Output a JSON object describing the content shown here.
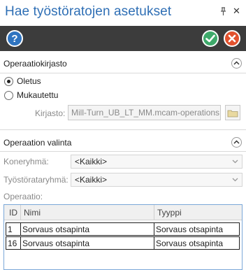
{
  "window": {
    "title": "Hae työstöratojen asetukset",
    "pin_glyph": "⌂",
    "close_glyph": "✕"
  },
  "toolbar": {
    "help_icon": "help-icon",
    "ok_icon": "check-icon",
    "cancel_icon": "cancel-icon"
  },
  "library_section": {
    "title": "Operaatiokirjasto",
    "options": [
      {
        "label": "Oletus",
        "checked": true
      },
      {
        "label": "Mukautettu",
        "checked": false
      }
    ],
    "library_label": "Kirjasto:",
    "library_value": "Mill-Turn_UB_LT_MM.mcam-operations"
  },
  "selection_section": {
    "title": "Operaation valinta",
    "machine_group_label": "Koneryhmä:",
    "machine_group_value": "<Kaikki>",
    "toolpath_group_label": "Työstörataryhmä:",
    "toolpath_group_value": "<Kaikki>",
    "operation_label": "Operaatio:"
  },
  "grid": {
    "columns": [
      "ID",
      "Nimi",
      "Tyyppi"
    ],
    "rows": [
      {
        "id": "1",
        "name": "Sorvaus otsapinta",
        "type": "Sorvaus otsapinta"
      },
      {
        "id": "16",
        "name": "Sorvaus otsapinta",
        "type": "Sorvaus otsapinta"
      }
    ]
  },
  "colors": {
    "title": "#2f6fb5",
    "toolbar_bg": "#3c3c3c",
    "help": "#2f74c0",
    "ok": "#3ea96a",
    "cancel": "#e2522e",
    "grid_border": "#7aa7d8"
  }
}
